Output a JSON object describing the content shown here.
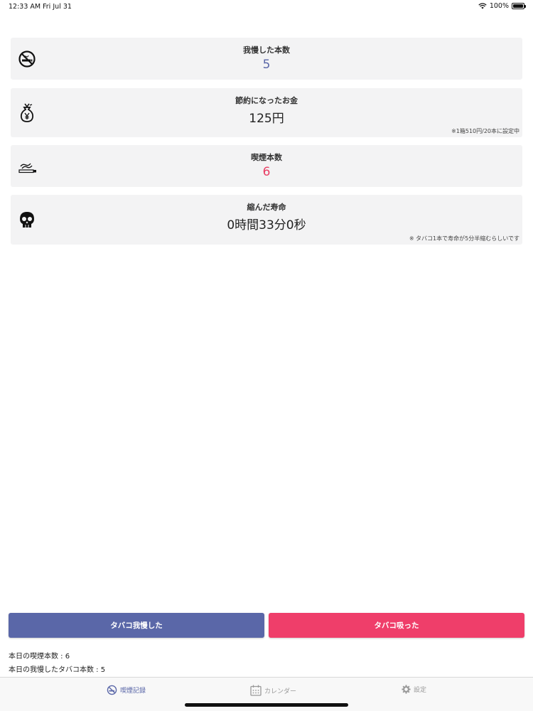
{
  "status_bar": {
    "time": "12:33 AM",
    "date": "Fri Jul 31",
    "battery": "100%"
  },
  "cards": [
    {
      "icon": "no-smoking-icon",
      "title": "我慢した本数",
      "value": "5",
      "value_color": "#5a67a8"
    },
    {
      "icon": "yen-money-bag-icon",
      "title": "節約になったお金",
      "value": "125円",
      "value_color": "#222222",
      "note": "※1箱510円/20本に設定中"
    },
    {
      "icon": "cigarette-icon",
      "title": "喫煙本数",
      "value": "6",
      "value_color": "#e83e64"
    },
    {
      "icon": "skull-icon",
      "title": "縮んだ寿命",
      "value": "0時間33分0秒",
      "value_color": "#222222",
      "note": "※ タバコ1本で寿命が5分半縮むらしいです"
    }
  ],
  "buttons": {
    "endure": {
      "label": "タバコ我慢した",
      "color": "#5a67a8"
    },
    "smoke": {
      "label": "タバコ吸った",
      "color": "#ef3e6a"
    }
  },
  "summary": {
    "today_smoked": "本日の喫煙本数 : 6",
    "today_endured": "本日の我慢したタバコ本数 : 5"
  },
  "tabs": [
    {
      "icon": "no-smoking-icon",
      "label": "喫煙記録",
      "active": true,
      "color": "#5a67a8"
    },
    {
      "icon": "calendar-icon",
      "label": "カレンダー",
      "active": false,
      "color": "#999999"
    },
    {
      "icon": "gear-icon",
      "label": "設定",
      "active": false,
      "color": "#999999"
    }
  ]
}
